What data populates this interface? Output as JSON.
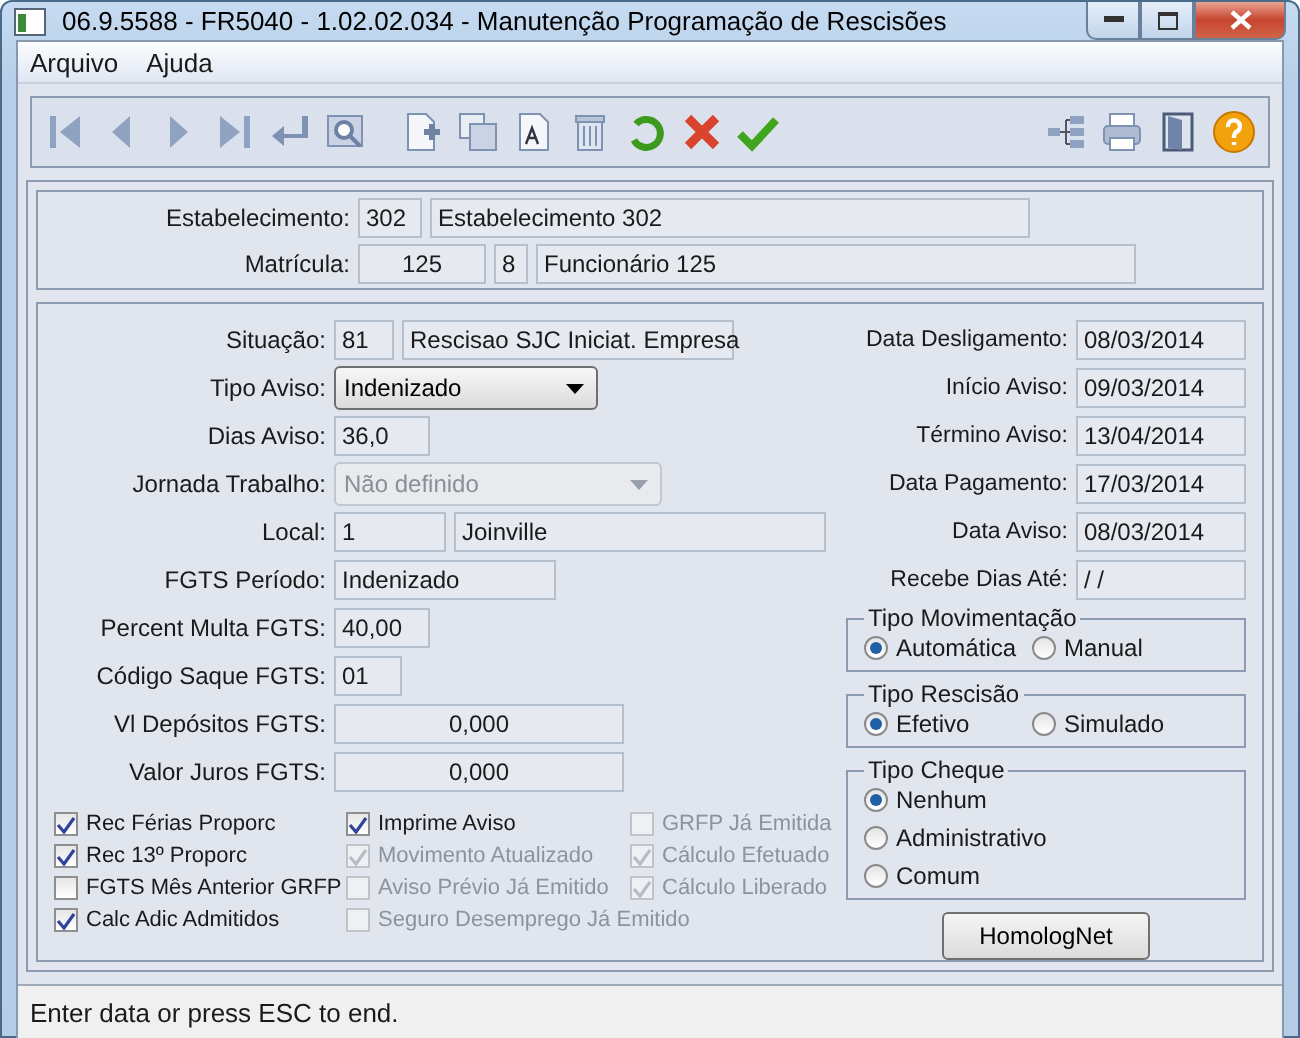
{
  "window": {
    "title": "06.9.5588 - FR5040 - 1.02.02.034 - Manutenção Programação de Rescisões"
  },
  "menu": [
    {
      "label": "Arquivo"
    },
    {
      "label": "Ajuda"
    }
  ],
  "header": {
    "establishment": {
      "label": "Estabelecimento:",
      "code": "302",
      "name": "Estabelecimento 302"
    },
    "employee": {
      "label": "Matrícula:",
      "code": "125",
      "digit": "8",
      "name": "Funcionário 125"
    }
  },
  "left_fields": [
    {
      "label": "Situação:",
      "kind": "text",
      "values": [
        "81",
        "Rescisao SJC Iniciat. Empresa"
      ]
    },
    {
      "label": "Tipo Aviso:",
      "kind": "select",
      "value": "Indenizado",
      "disabled": false
    },
    {
      "label": "Dias Aviso:",
      "kind": "text",
      "values": [
        "36,0"
      ]
    },
    {
      "label": "Jornada Trabalho:",
      "kind": "select",
      "value": "Não definido",
      "disabled": true
    },
    {
      "label": "Local:",
      "kind": "text",
      "values": [
        "1",
        "Joinville"
      ]
    },
    {
      "label": "FGTS Período:",
      "kind": "text",
      "values": [
        "Indenizado"
      ]
    },
    {
      "label": "Percent Multa FGTS:",
      "kind": "text",
      "values": [
        "40,00"
      ]
    },
    {
      "label": "Código Saque FGTS:",
      "kind": "text",
      "values": [
        "01"
      ]
    },
    {
      "label": "Vl Depósitos FGTS:",
      "kind": "number",
      "values": [
        "0,000"
      ]
    },
    {
      "label": "Valor Juros FGTS:",
      "kind": "number",
      "values": [
        "0,000"
      ]
    }
  ],
  "right_fields": [
    {
      "label": "Data Desligamento:",
      "value": "08/03/2014"
    },
    {
      "label": "Início Aviso:",
      "value": "09/03/2014"
    },
    {
      "label": "Término Aviso:",
      "value": "13/04/2014"
    },
    {
      "label": "Data Pagamento:",
      "value": "17/03/2014"
    },
    {
      "label": "Data Aviso:",
      "value": "08/03/2014"
    },
    {
      "label": "Recebe Dias Até:",
      "value": " / /"
    }
  ],
  "radio_groups": [
    {
      "title": "Tipo Movimentação",
      "kind": "row",
      "options": [
        {
          "label": "Automática",
          "selected": true
        },
        {
          "label": "Manual",
          "selected": false
        }
      ]
    },
    {
      "title": "Tipo Rescisão",
      "kind": "row",
      "options": [
        {
          "label": "Efetivo",
          "selected": true
        },
        {
          "label": "Simulado",
          "selected": false
        }
      ]
    },
    {
      "title": "Tipo Cheque",
      "kind": "column",
      "options": [
        {
          "label": "Nenhum",
          "selected": true
        },
        {
          "label": "Administrativo",
          "selected": false
        },
        {
          "label": "Comum",
          "selected": false
        }
      ]
    }
  ],
  "checkbox_columns": [
    [
      {
        "label": "Rec Férias Proporc",
        "checked": true,
        "disabled": false
      },
      {
        "label": "Rec 13º Proporc",
        "checked": true,
        "disabled": false
      },
      {
        "label": "FGTS Mês Anterior GRFP",
        "checked": false,
        "disabled": false
      },
      {
        "label": "Calc Adic Admitidos",
        "checked": true,
        "disabled": false
      }
    ],
    [
      {
        "label": "Imprime Aviso",
        "checked": true,
        "disabled": false
      },
      {
        "label": "Movimento Atualizado",
        "checked": true,
        "disabled": true
      },
      {
        "label": "Aviso Prévio Já Emitido",
        "checked": false,
        "disabled": true
      },
      {
        "label": "Seguro Desemprego Já Emitido",
        "checked": false,
        "disabled": true
      }
    ],
    [
      {
        "label": "GRFP Já Emitida",
        "checked": false,
        "disabled": true
      },
      {
        "label": "Cálculo Efetuado",
        "checked": true,
        "disabled": true
      },
      {
        "label": "Cálculo Liberado",
        "checked": true,
        "disabled": true
      }
    ]
  ],
  "button": "HomologNet",
  "status_bar": "Enter data or press ESC to end."
}
